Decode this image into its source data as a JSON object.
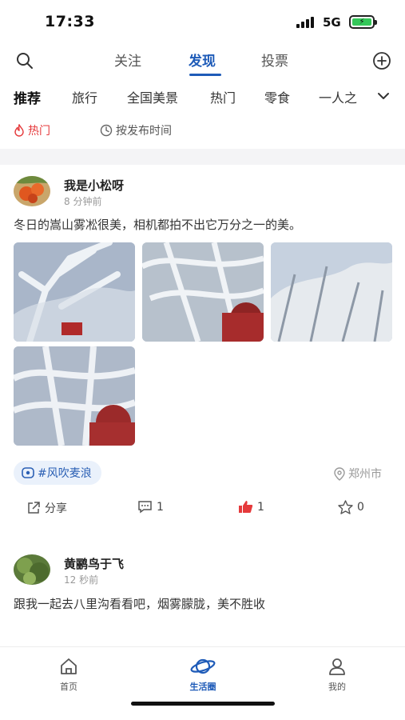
{
  "status_bar": {
    "time": "17:33",
    "network": "5G"
  },
  "top_nav": {
    "tabs": [
      {
        "label": "关注",
        "active": false
      },
      {
        "label": "发现",
        "active": true
      },
      {
        "label": "投票",
        "active": false
      }
    ]
  },
  "categories": [
    "推荐",
    "旅行",
    "全国美景",
    "热门",
    "零食",
    "一人之"
  ],
  "sort": {
    "hot": "热门",
    "by_time": "按发布时间"
  },
  "posts": [
    {
      "author": "我是小松呀",
      "time": "8 分钟前",
      "text": "冬日的嵩山雾凇很美，相机都拍不出它万分之一的美。",
      "topic": "#风吹麦浪",
      "location": "郑州市",
      "actions": {
        "share": "分享",
        "comments": "1",
        "likes": "1",
        "favorites": "0"
      }
    },
    {
      "author": "黄鹂鸟于飞",
      "time": "12 秒前",
      "text": "跟我一起去八里沟看看吧，烟雾朦胧，美不胜收"
    }
  ],
  "bottom_tabs": [
    {
      "label": "首页",
      "active": false
    },
    {
      "label": "生活圈",
      "active": true
    },
    {
      "label": "我的",
      "active": false
    }
  ],
  "colors": {
    "accent": "#1e5bb8",
    "hot": "#e5393b",
    "like": "#e5393b",
    "tag_bg": "#eaf1fb"
  }
}
